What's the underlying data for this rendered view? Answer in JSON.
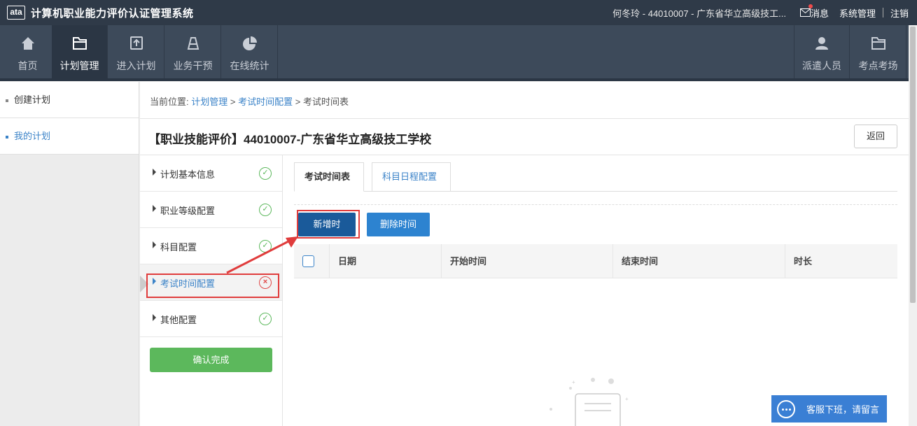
{
  "app": {
    "logo": "ata",
    "title": "计算机职业能力评价认证管理系统"
  },
  "topbar": {
    "user": "何冬玲 - 44010007 - 广东省华立高级技工...",
    "messages": "消息",
    "settings": "系统管理",
    "logout": "注销"
  },
  "nav": {
    "items": [
      {
        "label": "首页",
        "icon": "home-icon"
      },
      {
        "label": "计划管理",
        "icon": "folder-icon"
      },
      {
        "label": "进入计划",
        "icon": "enter-icon"
      },
      {
        "label": "业务干预",
        "icon": "cone-icon"
      },
      {
        "label": "在线统计",
        "icon": "pie-chart-icon"
      }
    ],
    "right": [
      {
        "label": "派遣人员",
        "icon": "person-icon"
      },
      {
        "label": "考点考场",
        "icon": "folder-icon"
      }
    ]
  },
  "sidebar": {
    "items": [
      {
        "label": "创建计划"
      },
      {
        "label": "我的计划"
      }
    ]
  },
  "breadcrumb": {
    "prefix": "当前位置:",
    "level1": "计划管理",
    "level2": "考试时间配置",
    "level3": "考试时间表",
    "sep": ">"
  },
  "page": {
    "title": "【职业技能评价】44010007-广东省华立高级技工学校",
    "back": "返回"
  },
  "steps": [
    {
      "label": "计划基本信息",
      "status": "done"
    },
    {
      "label": "职业等级配置",
      "status": "done"
    },
    {
      "label": "科目配置",
      "status": "done"
    },
    {
      "label": "考试时间配置",
      "status": "error"
    },
    {
      "label": "其他配置",
      "status": "done"
    }
  ],
  "confirm": "确认完成",
  "tabs": [
    {
      "label": "考试时间表"
    },
    {
      "label": "科目日程配置"
    }
  ],
  "actions": {
    "add": "新增时间",
    "delete": "删除时间"
  },
  "table": {
    "columns": [
      "日期",
      "开始时间",
      "结束时间",
      "时长"
    ]
  },
  "chat": {
    "label": "客服下班，请留言"
  },
  "colors": {
    "topbar": "#2f3a48",
    "nav": "#3d4a5a",
    "accent": "#3b83c8",
    "success": "#5cb85c",
    "danger": "#e04848"
  }
}
